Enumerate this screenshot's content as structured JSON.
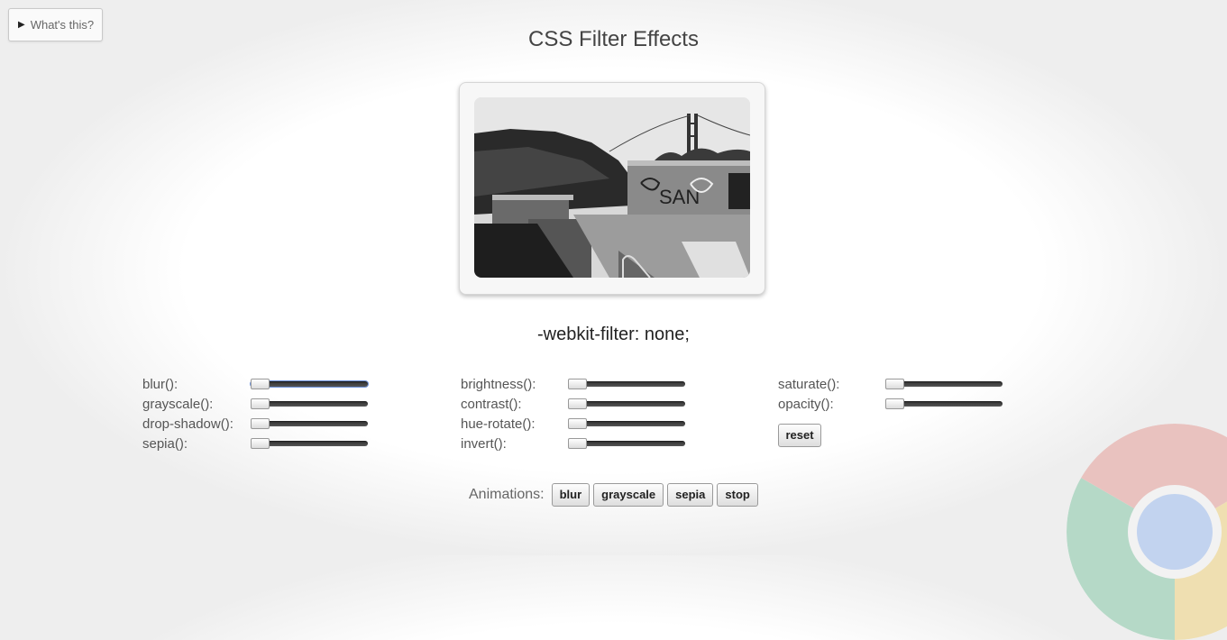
{
  "whats_this": {
    "arrow": "▶",
    "label": "What's this?"
  },
  "title": "CSS Filter Effects",
  "filter_readout": "-webkit-filter: none;",
  "controls": {
    "col1": [
      {
        "label": "blur():",
        "value": 0,
        "focused": true
      },
      {
        "label": "grayscale():",
        "value": 0
      },
      {
        "label": "drop-shadow():",
        "value": 0
      },
      {
        "label": "sepia():",
        "value": 0
      }
    ],
    "col2": [
      {
        "label": "brightness():",
        "value": 0
      },
      {
        "label": "contrast():",
        "value": 0
      },
      {
        "label": "hue-rotate():",
        "value": 0
      },
      {
        "label": "invert():",
        "value": 0
      }
    ],
    "col3": [
      {
        "label": "saturate():",
        "value": 0
      },
      {
        "label": "opacity():",
        "value": 0
      }
    ],
    "reset_label": "reset"
  },
  "animations": {
    "label": "Animations:",
    "buttons": [
      "blur",
      "grayscale",
      "sepia",
      "stop"
    ]
  },
  "colors": {
    "accent_focus": "#6a8fd8",
    "track": "#3a3a3a"
  },
  "photo": {
    "subject": "black and white photo of graffiti-covered bunkers with a suspension bridge tower in the background"
  }
}
